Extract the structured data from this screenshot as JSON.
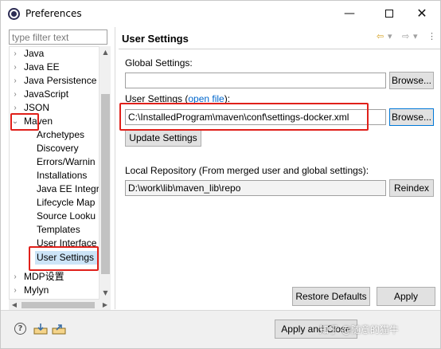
{
  "window": {
    "title": "Preferences",
    "minimize": "—",
    "close": "✕"
  },
  "filter": {
    "placeholder": "type filter text"
  },
  "tree": {
    "items": [
      {
        "label": "Java",
        "arrow": "›"
      },
      {
        "label": "Java EE",
        "arrow": "›"
      },
      {
        "label": "Java Persistence",
        "arrow": "›"
      },
      {
        "label": "JavaScript",
        "arrow": "›"
      },
      {
        "label": "JSON",
        "arrow": "›"
      },
      {
        "label": "Maven",
        "arrow": "⌄"
      },
      {
        "label": "Archetypes"
      },
      {
        "label": "Discovery"
      },
      {
        "label": "Errors/Warnin"
      },
      {
        "label": "Installations"
      },
      {
        "label": "Java EE Integra"
      },
      {
        "label": "Lifecycle Map"
      },
      {
        "label": "Source Looku"
      },
      {
        "label": "Templates"
      },
      {
        "label": "User Interface"
      },
      {
        "label": "User Settings"
      },
      {
        "label": "MDP设置",
        "arrow": "›"
      },
      {
        "label": "Mylyn",
        "arrow": "›"
      }
    ]
  },
  "page": {
    "title": "User Settings",
    "nav_back": "⇦",
    "nav_back_menu": "▾",
    "nav_fwd": "⇨",
    "nav_fwd_menu": "▾",
    "nav_more": "⋮",
    "global_label": "Global Settings:",
    "global_value": "",
    "browse_label": "Browse...",
    "user_label_prefix": "User Settings (",
    "user_label_link": "open file",
    "user_label_suffix": "):",
    "user_value": "C:\\InstalledProgram\\maven\\conf\\settings-docker.xml",
    "update_label": "Update Settings",
    "local_repo_label": "Local Repository (From merged user and global settings):",
    "local_repo_value": "D:\\work\\lib\\maven_lib\\repo",
    "reindex_label": "Reindex",
    "restore_label": "Restore Defaults",
    "apply_label": "Apply"
  },
  "footer": {
    "help": "?",
    "apply_close_label": "Apply and Close",
    "watermark": "知乎 @随意的猫牛"
  },
  "colors": {
    "highlight_box": "#e0201a",
    "selection": "#cce4f7",
    "link": "#0066cc",
    "focus": "#0078d7"
  }
}
